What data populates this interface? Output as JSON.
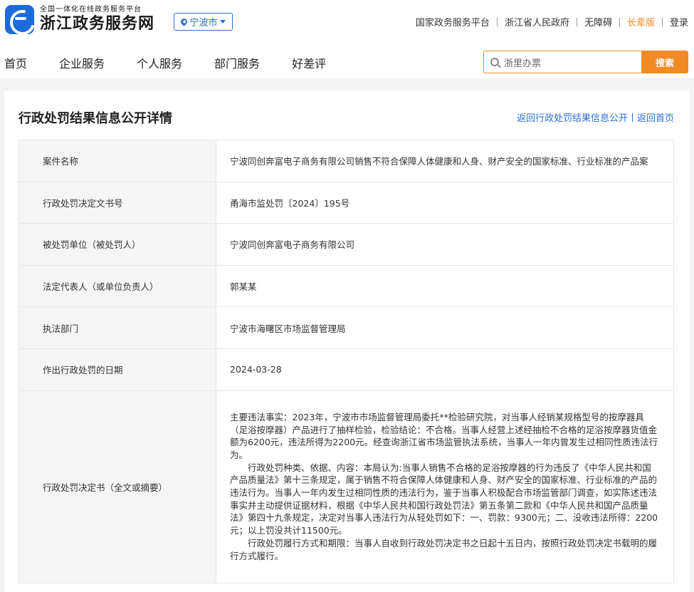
{
  "header": {
    "logo_subtitle": "全国一体化在线政务服务平台",
    "logo_title": "浙江政务服务网",
    "city": "宁波市",
    "top_links": [
      "国家政务服务平台",
      "浙江省人民政府",
      "无障碍",
      "长辈版",
      "登录"
    ],
    "nav": [
      "首页",
      "企业服务",
      "个人服务",
      "部门服务",
      "好差评"
    ],
    "search_placeholder": "浙里办票",
    "search_button": "搜索",
    "accent_color": "#f08a24",
    "brand_color": "#2a6fd3"
  },
  "page": {
    "title": "行政处罚结果信息公开详情",
    "back_list": "返回行政处罚结果信息公开",
    "back_home": "返回首页"
  },
  "rows": [
    {
      "label": "案件名称",
      "value": "宁波同创奔富电子商务有限公司销售不符合保障人体健康和人身、财产安全的国家标准、行业标准的产品案"
    },
    {
      "label": "行政处罚决定文书号",
      "value": "甬海市监处罚〔2024〕195号"
    },
    {
      "label": "被处罚单位（被处罚人）",
      "value": "宁波同创奔富电子商务有限公司"
    },
    {
      "label": "法定代表人（或单位负责人）",
      "value": "郭某某"
    },
    {
      "label": "执法部门",
      "value": "宁波市海曙区市场监督管理局"
    },
    {
      "label": "作出行政处罚的日期",
      "value": "2024-03-28"
    },
    {
      "label": "行政处罚决定书（全文或摘要）",
      "paragraphs": [
        "主要违法事实：2023年，宁波市市场监督管理局委托**检验研究院，对当事人经销某规格型号的按摩器具（足浴按摩器）产品进行了抽样检验，检验结论：不合格。当事人经营上述经抽检不合格的足浴按摩器货值金额为6200元，违法所得为2200元。经查询浙江省市场监管执法系统，当事人一年内曾发生过相同性质违法行为。",
        "行政处罚种类、依据、内容：本局认为:当事人销售不合格的足浴按摩器的行为违反了《中华人民共和国产品质量法》第十三条规定，属于销售不符合保障人体健康和人身、财产安全的国家标准、行业标准的产品的违法行为。当事人一年内发生过相同性质的违法行为，鉴于当事人积极配合市场监管部门调查，如实陈述违法事实并主动提供证据材料，根据《中华人民共和国行政处罚法》第五条第二款和《中华人民共和国产品质量法》第四十九条规定，决定对当事人违法行为从轻处罚如下：一、罚款：9300元；二、没收违法所得：2200元；以上罚没共计11500元。",
        "行政处罚履行方式和期限：当事人自收到行政处罚决定书之日起十五日内，按照行政处罚决定书载明的履行方式履行。"
      ]
    }
  ]
}
